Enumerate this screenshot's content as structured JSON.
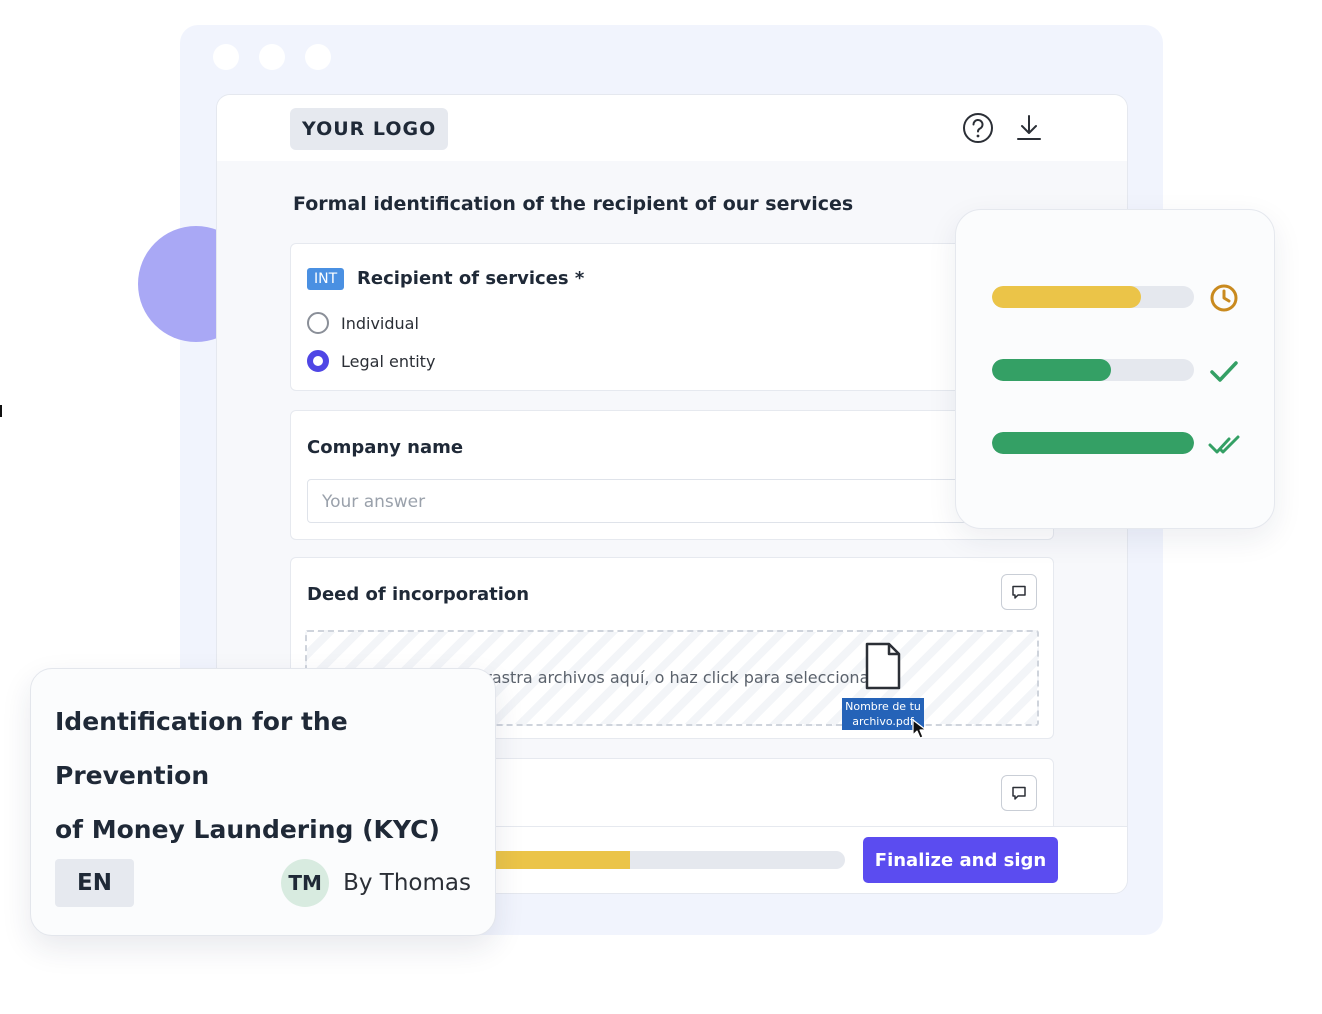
{
  "header": {
    "logo": "YOUR LOGO",
    "help_icon": "question-circle-icon",
    "download_icon": "download-icon"
  },
  "form": {
    "section_title": "Formal identification of the recipient of our services",
    "recipient": {
      "badge": "INT",
      "label": "Recipient of services *",
      "options": [
        {
          "label": "Individual",
          "selected": false
        },
        {
          "label": "Legal entity",
          "selected": true
        }
      ]
    },
    "company": {
      "label": "Company name",
      "placeholder": "Your answer"
    },
    "deed": {
      "label": "Deed of incorporation",
      "dropzone_text": "Arrastra archivos aquí, o haz click para seleccionar",
      "file_label_line1": "Nombre de tu",
      "file_label_line2": "archivo.pdf"
    },
    "progress": 0.4,
    "finalize_label": "Finalize and sign"
  },
  "status": {
    "rows": [
      {
        "progress": 0.74,
        "color": "#ebc448",
        "icon": "clock-icon",
        "icon_color": "#c98a1f"
      },
      {
        "progress": 0.59,
        "color": "#34a065",
        "icon": "check-icon",
        "icon_color": "#34a065"
      },
      {
        "progress": 1.0,
        "color": "#34a065",
        "icon": "double-check-icon",
        "icon_color": "#34a065"
      }
    ]
  },
  "kyc": {
    "title_line1": "Identification for the Prevention",
    "title_line2": "of Money Laundering (KYC)",
    "language": "EN",
    "avatar_initials": "TM",
    "author": "By Thomas"
  },
  "colors": {
    "accent": "#5b4cf0",
    "radio_selected": "#4f46e5",
    "badge_blue": "#4a90e2",
    "progress_yellow": "#ebc448",
    "success_green": "#34a065"
  }
}
